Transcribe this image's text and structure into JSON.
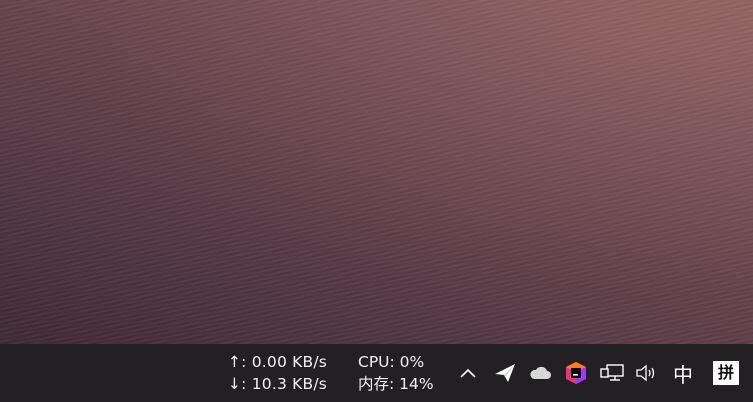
{
  "taskbar": {
    "net_speed": {
      "upload": "↑: 0.00 KB/s",
      "download": "↓: 10.3 KB/s"
    },
    "system": {
      "cpu": "CPU: 0%",
      "memory": "内存: 14%"
    },
    "tray_icons": [
      "show-hidden-icons-chevron",
      "send-app-icon",
      "onedrive-cloud-icon",
      "jetbrains-toolbox-icon",
      "network-icon",
      "volume-icon"
    ],
    "ime": {
      "language": "中",
      "mode": "拼"
    },
    "colors": {
      "taskbar_bg": "#222022",
      "text": "#f2f2f2",
      "wallpaper_top": "#8a5f62",
      "wallpaper_bottom": "#3f2b35"
    }
  }
}
